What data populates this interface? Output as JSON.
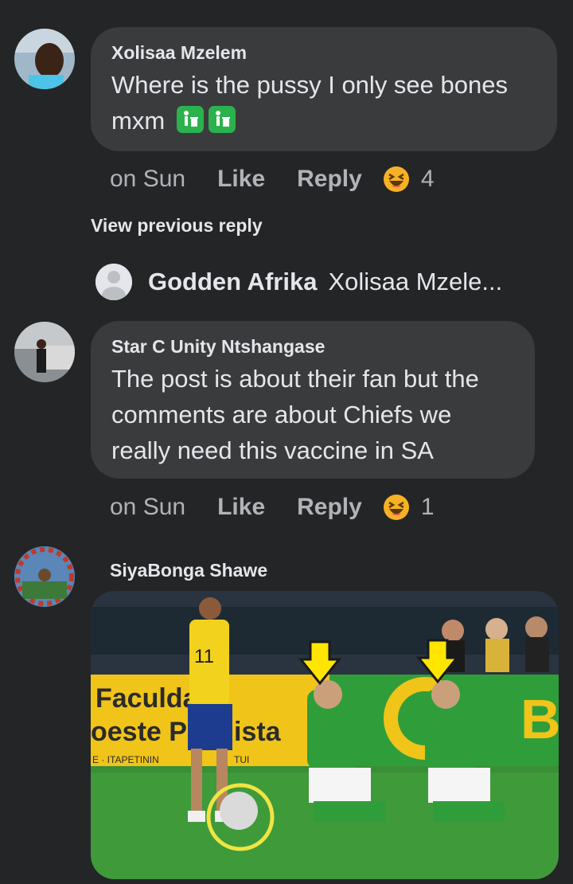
{
  "comments": [
    {
      "author": "Xolisaa Mzelem",
      "text": "Where is the pussy I only see bones mxm",
      "time": "on Sun",
      "like_label": "Like",
      "reply_label": "Reply",
      "reaction": "laughing-emoji",
      "reaction_count": "4"
    },
    {
      "author": "Star C Unity Ntshangase",
      "text": "The post is about their fan but the comments are about Chiefs we really need this vaccine in SA",
      "time": "on Sun",
      "like_label": "Like",
      "reply_label": "Reply",
      "reaction": "laughing-emoji",
      "reaction_count": "1"
    },
    {
      "author": "SiyaBonga Shawe"
    }
  ],
  "view_previous_reply": "View previous reply",
  "reply_preview": {
    "author": "Godden Afrika",
    "text": "Xolisaa Mzele..."
  },
  "image_banner": {
    "line1": "Faculda",
    "line2": "oeste P",
    "line2b": "ista",
    "line3": "E · ITAPETININ",
    "line3b": "TUI"
  },
  "colors": {
    "background": "#242526",
    "bubble": "#3a3b3c",
    "text": "#e4e6eb",
    "secondary": "#b0b3b8",
    "reaction_yellow": "#f7b125"
  }
}
